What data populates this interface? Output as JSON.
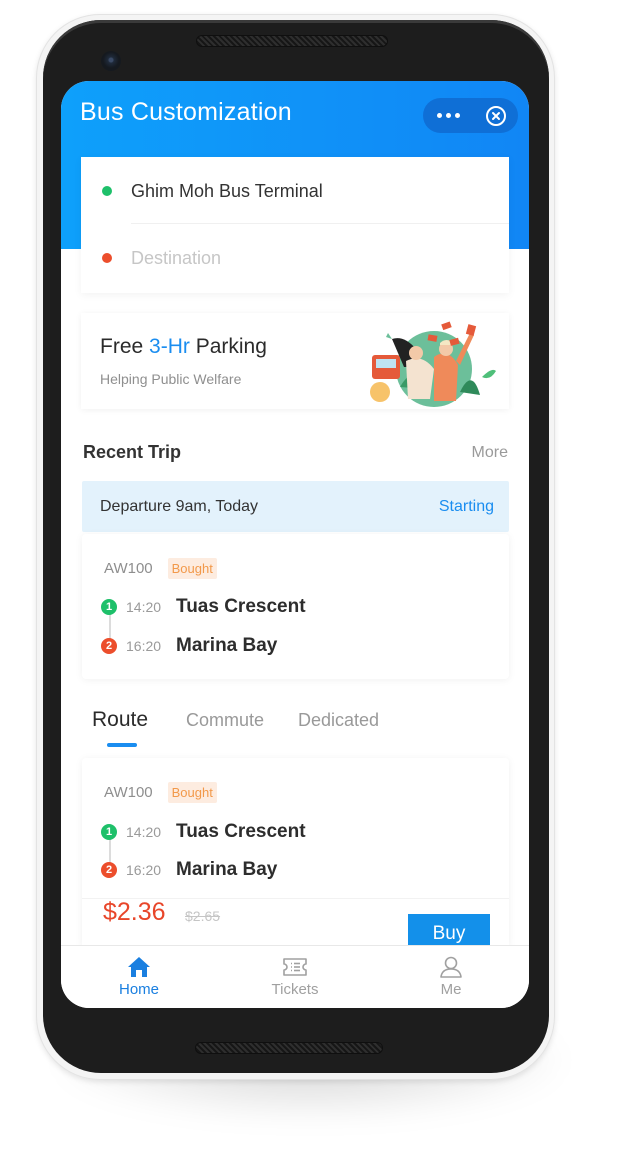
{
  "header": {
    "title": "Bus Customization",
    "more_icon": "ellipsis-icon",
    "close_icon": "close-circle-icon",
    "gradient_start": "#0ea0fb",
    "gradient_end": "#1186f5"
  },
  "location": {
    "origin_value": "Ghim Moh Bus Terminal",
    "destination_placeholder": "Destination",
    "origin_dot_color": "#1ec06a",
    "destination_dot_color": "#ec4e2c"
  },
  "promo": {
    "title_prefix": "Free ",
    "title_highlight": "3-Hr",
    "title_suffix": " Parking",
    "subtitle": "Helping Public Welfare",
    "illustration": "people-celebrating-illustration"
  },
  "recent_trip": {
    "section_title": "Recent Trip",
    "more_label": "More",
    "departure_text": "Departure 9am, Today",
    "departure_status": "Starting",
    "trip": {
      "bus_code": "AW100",
      "badge": "Bought",
      "stops": [
        {
          "num": "1",
          "time": "14:20",
          "name": "Tuas Crescent",
          "color": "#1ec06a"
        },
        {
          "num": "2",
          "time": "16:20",
          "name": "Marina Bay",
          "color": "#ec4e2c"
        }
      ]
    }
  },
  "tabs": {
    "items": [
      {
        "label": "Route",
        "active": true
      },
      {
        "label": "Commute",
        "active": false
      },
      {
        "label": "Dedicated",
        "active": false
      }
    ]
  },
  "route_card": {
    "bus_code": "AW100",
    "badge": "Bought",
    "stops": [
      {
        "num": "1",
        "time": "14:20",
        "name": "Tuas Crescent",
        "color": "#1ec06a"
      },
      {
        "num": "2",
        "time": "16:20",
        "name": "Marina Bay",
        "color": "#ec4e2c"
      }
    ],
    "price": "$2.36",
    "original_price": "$2.65",
    "buy_label": "Buy"
  },
  "bottom_nav": {
    "items": [
      {
        "label": "Home",
        "icon": "home-icon",
        "active": true
      },
      {
        "label": "Tickets",
        "icon": "ticket-icon",
        "active": false
      },
      {
        "label": "Me",
        "icon": "user-icon",
        "active": false
      }
    ],
    "active_color": "#1a7fe0",
    "inactive_color": "#a0a0a0"
  }
}
